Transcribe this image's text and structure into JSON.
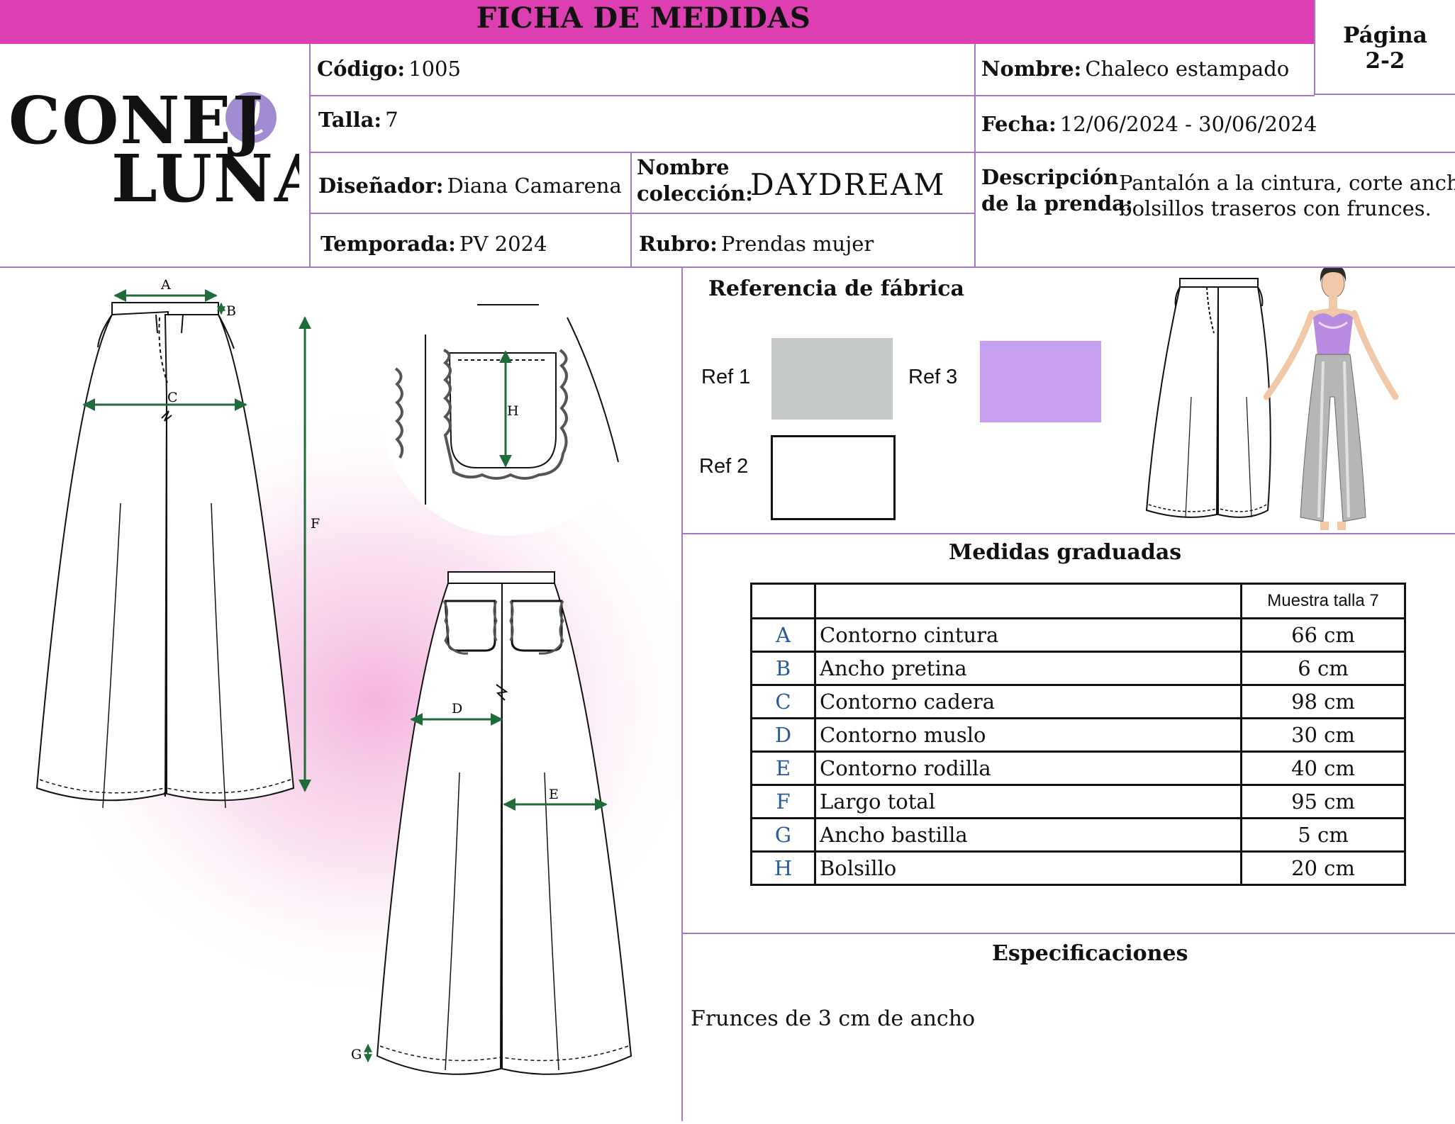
{
  "header": {
    "title": "FICHA DE MEDIDAS",
    "page_label": "Página",
    "page_value": "2-2"
  },
  "brand": {
    "line1": "CONEJ",
    "line2": "LUNAR"
  },
  "fields": {
    "codigo_label": "Código:",
    "codigo_value": "1005",
    "nombre_label": "Nombre:",
    "nombre_value": "Chaleco estampado",
    "talla_label": "Talla:",
    "talla_value": "7",
    "fecha_label": "Fecha:",
    "fecha_value": "12/06/2024 - 30/06/2024",
    "disenador_label": "Diseñador:",
    "disenador_value": "Diana Camarena",
    "coleccion_label_1": "Nombre",
    "coleccion_label_2": "colección:",
    "coleccion_value": "DAYDREAM",
    "descripcion_label_1": "Descripción",
    "descripcion_label_2": "de la prenda:",
    "descripcion_value_1": "Pantalón a la cintura, corte ancho,",
    "descripcion_value_2": "bolsillos traseros con frunces.",
    "temporada_label": "Temporada:",
    "temporada_value": "PV 2024",
    "rubro_label": "Rubro:",
    "rubro_value": "Prendas mujer"
  },
  "fabric": {
    "title": "Referencia de fábrica",
    "refs": [
      {
        "label": "Ref 1",
        "color": "#c6cac8"
      },
      {
        "label": "Ref 2",
        "color": "#ffffff"
      },
      {
        "label": "Ref 3",
        "color": "#c8a0f2"
      }
    ]
  },
  "measure_marks": [
    "A",
    "B",
    "C",
    "D",
    "E",
    "F",
    "G",
    "H"
  ],
  "measures": {
    "title": "Medidas graduadas",
    "column_header": "Muestra talla 7",
    "rows": [
      {
        "key": "A",
        "name": "Contorno cintura",
        "value": "66 cm"
      },
      {
        "key": "B",
        "name": "Ancho pretina",
        "value": "6 cm"
      },
      {
        "key": "C",
        "name": "Contorno cadera",
        "value": "98 cm"
      },
      {
        "key": "D",
        "name": "Contorno muslo",
        "value": "30 cm"
      },
      {
        "key": "E",
        "name": "Contorno rodilla",
        "value": "40 cm"
      },
      {
        "key": "F",
        "name": "Largo total",
        "value": "95 cm"
      },
      {
        "key": "G",
        "name": "Ancho bastilla",
        "value": "5 cm"
      },
      {
        "key": "H",
        "name": "Bolsillo",
        "value": "20 cm"
      }
    ]
  },
  "specs": {
    "title": "Especificaciones",
    "text": "Frunces de 3 cm de ancho"
  },
  "colors": {
    "banner": "#dd3fb3",
    "grid_lines": "#a678c6",
    "measure_lines": "#1f6b3a",
    "table_keys": "#2a5b9a"
  }
}
